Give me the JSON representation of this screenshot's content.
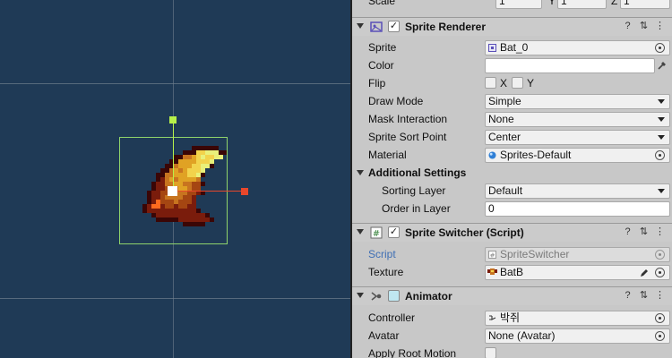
{
  "scene": {
    "colors": {
      "background": "#1f3a56",
      "selection": "#8fd36b",
      "gizmo_x": "#e8472b",
      "gizmo_y": "#b7f04a"
    }
  },
  "inspector": {
    "transform_scale": {
      "label": "Scale",
      "y_label": "Y",
      "z_label": "Z",
      "x": "1",
      "y": "1",
      "z": "1"
    },
    "sprite_renderer": {
      "title": "Sprite Renderer",
      "sprite": {
        "label": "Sprite",
        "value": "Bat_0"
      },
      "color": {
        "label": "Color"
      },
      "flip": {
        "label": "Flip",
        "x": "X",
        "y": "Y"
      },
      "draw_mode": {
        "label": "Draw Mode",
        "value": "Simple"
      },
      "mask_interaction": {
        "label": "Mask Interaction",
        "value": "None"
      },
      "sort_point": {
        "label": "Sprite Sort Point",
        "value": "Center"
      },
      "material": {
        "label": "Material",
        "value": "Sprites-Default"
      },
      "additional": {
        "title": "Additional Settings",
        "sorting_layer": {
          "label": "Sorting Layer",
          "value": "Default"
        },
        "order": {
          "label": "Order in Layer",
          "value": "0"
        }
      }
    },
    "sprite_switcher": {
      "title": "Sprite Switcher (Script)",
      "script": {
        "label": "Script",
        "value": "SpriteSwitcher"
      },
      "texture": {
        "label": "Texture",
        "value": "BatB"
      }
    },
    "animator": {
      "title": "Animator",
      "controller": {
        "label": "Controller",
        "value": "박쥐"
      },
      "avatar": {
        "label": "Avatar",
        "value": "None (Avatar)"
      },
      "apply_root_motion": {
        "label": "Apply Root Motion"
      }
    },
    "header_icons": {
      "help": "?",
      "settings": "⇅",
      "menu": "⋮"
    }
  }
}
